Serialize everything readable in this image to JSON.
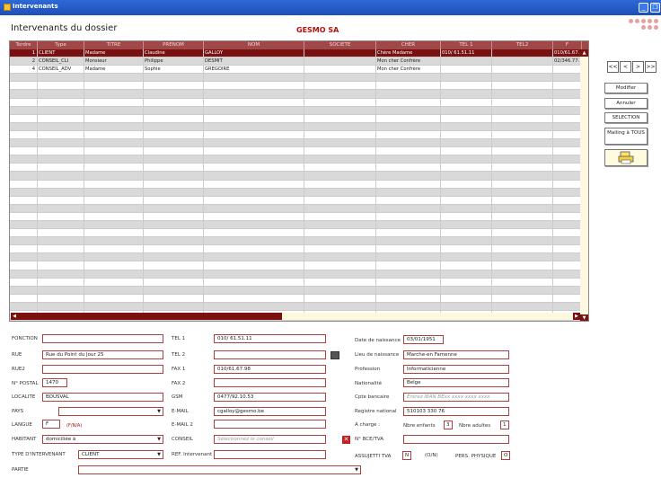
{
  "window": {
    "title": "Intervenants"
  },
  "header": {
    "title": "Intervenants du dossier",
    "company": "GESMO SA"
  },
  "grid": {
    "columns": [
      "Tordre",
      "Type",
      "TITRE",
      "PRENOM",
      "NOM",
      "SOCIETE",
      "CHER",
      "TEL 1",
      "TEL2",
      "F"
    ],
    "rows": [
      {
        "ordre": "1",
        "type": "CLIENT",
        "titre": "Madame",
        "prenom": "Claudine",
        "nom": "GALLOY",
        "societe": "",
        "cher": "Chère Madame",
        "tel1": "010/ 61.51.11",
        "tel2": "",
        "fax": "010/61.67.",
        "selected": true
      },
      {
        "ordre": "2",
        "type": "CONSEIL_CLI",
        "titre": "Monsieur",
        "prenom": "Philippe",
        "nom": "DESMIT",
        "societe": "",
        "cher": "Mon cher Confrère",
        "tel1": "",
        "tel2": "",
        "fax": "02/346.77.",
        "selected": false
      },
      {
        "ordre": "4",
        "type": "CONSEIL_ADV",
        "titre": "Madame",
        "prenom": "Sophie",
        "nom": "GREGOIRE",
        "societe": "",
        "cher": "Mon cher Confrère",
        "tel1": "",
        "tel2": "",
        "fax": "",
        "selected": false
      }
    ]
  },
  "nav": {
    "first": "<<",
    "prev": "<",
    "next": ">",
    "last": ">>"
  },
  "side_buttons": {
    "modifier": "Modifier",
    "annuler": "Annuler",
    "selection": "SELECTION",
    "mailing": "Mailing à TOUS"
  },
  "form": {
    "fonction": {
      "label": "FONCTION",
      "value": ""
    },
    "rue": {
      "label": "RUE",
      "value": "Rue du Point du Jour 25"
    },
    "rue2": {
      "label": "RUE2",
      "value": ""
    },
    "postal": {
      "label": "N° POSTAL",
      "value": "1470"
    },
    "localite": {
      "label": "LOCALITE",
      "value": "BOUSVAL"
    },
    "pays": {
      "label": "PAYS",
      "value": ""
    },
    "langue": {
      "label": "LANGUE",
      "value": "F",
      "hint": "(F/N/A)"
    },
    "habitant": {
      "label": "HABITANT",
      "value": "domiciliée à"
    },
    "type_intervenant": {
      "label": "TYPE D'INTERVENANT",
      "value": "CLIENT"
    },
    "partie": {
      "label": "PARTIE",
      "value": ""
    },
    "tel1": {
      "label": "TEL 1",
      "value": "010/ 61.51.11"
    },
    "tel2": {
      "label": "TEL 2",
      "value": ""
    },
    "fax1": {
      "label": "FAX 1",
      "value": "010/61.67.98"
    },
    "fax2": {
      "label": "FAX 2",
      "value": ""
    },
    "gsm": {
      "label": "GSM",
      "value": "0477/92.10.53"
    },
    "email": {
      "label": "E-MAIL",
      "value": "cgalloy@gesmo.be"
    },
    "email2": {
      "label": "E-MAIL 2",
      "value": ""
    },
    "conseil": {
      "label": "CONSEIL",
      "placeholder": "Sélectionnez le conseil"
    },
    "ref": {
      "label": "REF. Intervenant",
      "value": ""
    },
    "naissance": {
      "label": "Date de naissance",
      "value": "03/01/1951"
    },
    "lieu": {
      "label": "Lieu de naissance",
      "value": "Marche-en Famenne"
    },
    "profession": {
      "label": "Profession",
      "value": "Informaticienne"
    },
    "nationalite": {
      "label": "Nationalité",
      "value": "Belge"
    },
    "cpte": {
      "label": "Cpte bancaire",
      "placeholder": "Entrez IBAN BExx xxxx xxxx xxxx"
    },
    "registre": {
      "label": "Registre national",
      "value": "510103 330 76"
    },
    "charge": {
      "label": "A charge :",
      "enfants_label": "Nbre enfants",
      "enfants": "3",
      "adultes_label": "Nbre adultes",
      "adultes": "1"
    },
    "bce": {
      "label": "N° BCE/TVA",
      "value": ""
    },
    "tva": {
      "label": "ASSUJETTI TVA",
      "value": "N",
      "hint": "(O/N)"
    },
    "pers": {
      "label": "PERS. PHYSIQUE",
      "value": "O"
    }
  }
}
